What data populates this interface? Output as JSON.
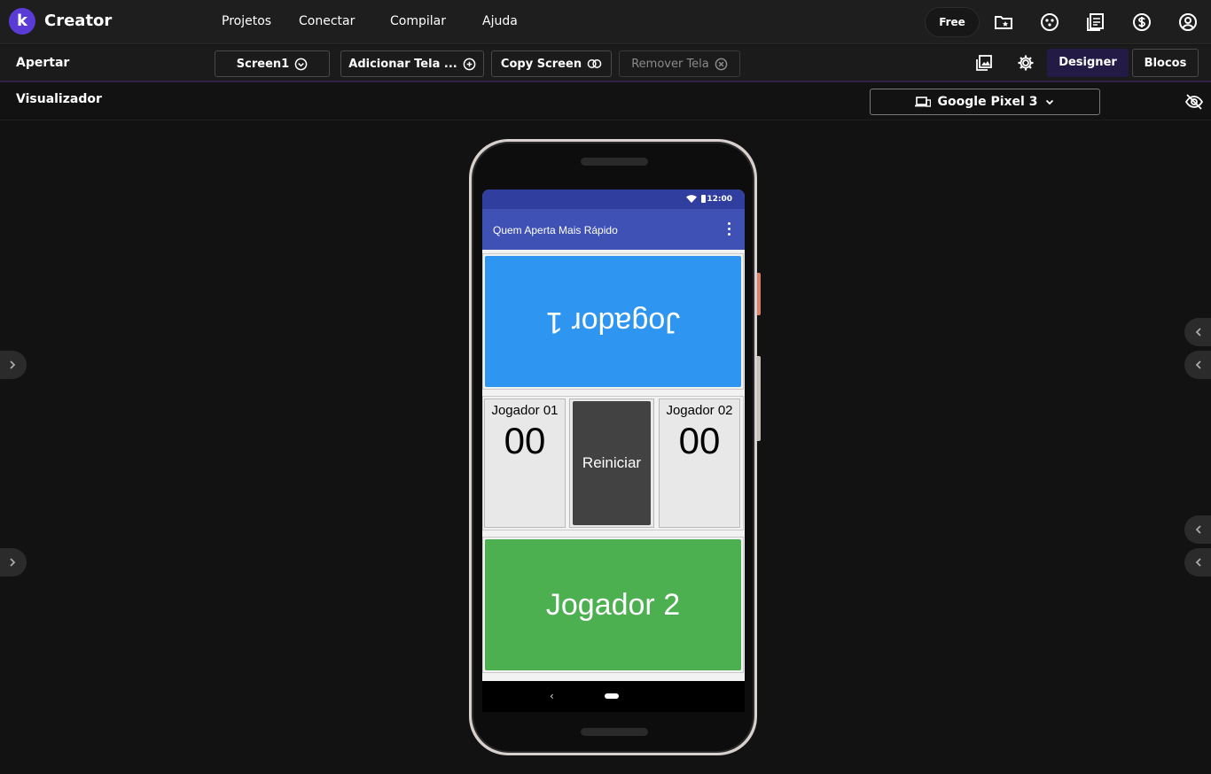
{
  "app": {
    "brand_letter": "k",
    "brand": "Creator",
    "menu": [
      "Projetos",
      "Conectar",
      "Compilar",
      "Ajuda"
    ],
    "plan": "Free",
    "top_icons": [
      "new-folder-icon",
      "palette-icon",
      "news-icon",
      "dollar-icon",
      "account-icon"
    ]
  },
  "toolbar": {
    "project_name": "Apertar",
    "screen_select": "Screen1",
    "add_screen": "Adicionar Tela ...",
    "copy_screen": "Copy Screen",
    "remove_screen": "Remover Tela",
    "designer_tab": "Designer",
    "blocks_tab": "Blocos",
    "accent": "#231b45"
  },
  "viewer": {
    "label": "Visualizador",
    "device": "Google Pixel 3"
  },
  "phone_app": {
    "status_time": "12:00",
    "title": "Quem Aperta Mais Rápido",
    "player1_button": "Jogador 1",
    "player1_color": "#2e95f0",
    "score1_label": "Jogador 01",
    "score1_value": "00",
    "reset_button": "Reiniciar",
    "score2_label": "Jogador 02",
    "score2_value": "00",
    "player2_button": "Jogador 2",
    "player2_color": "#4caf50",
    "back_glyph": "‹"
  }
}
